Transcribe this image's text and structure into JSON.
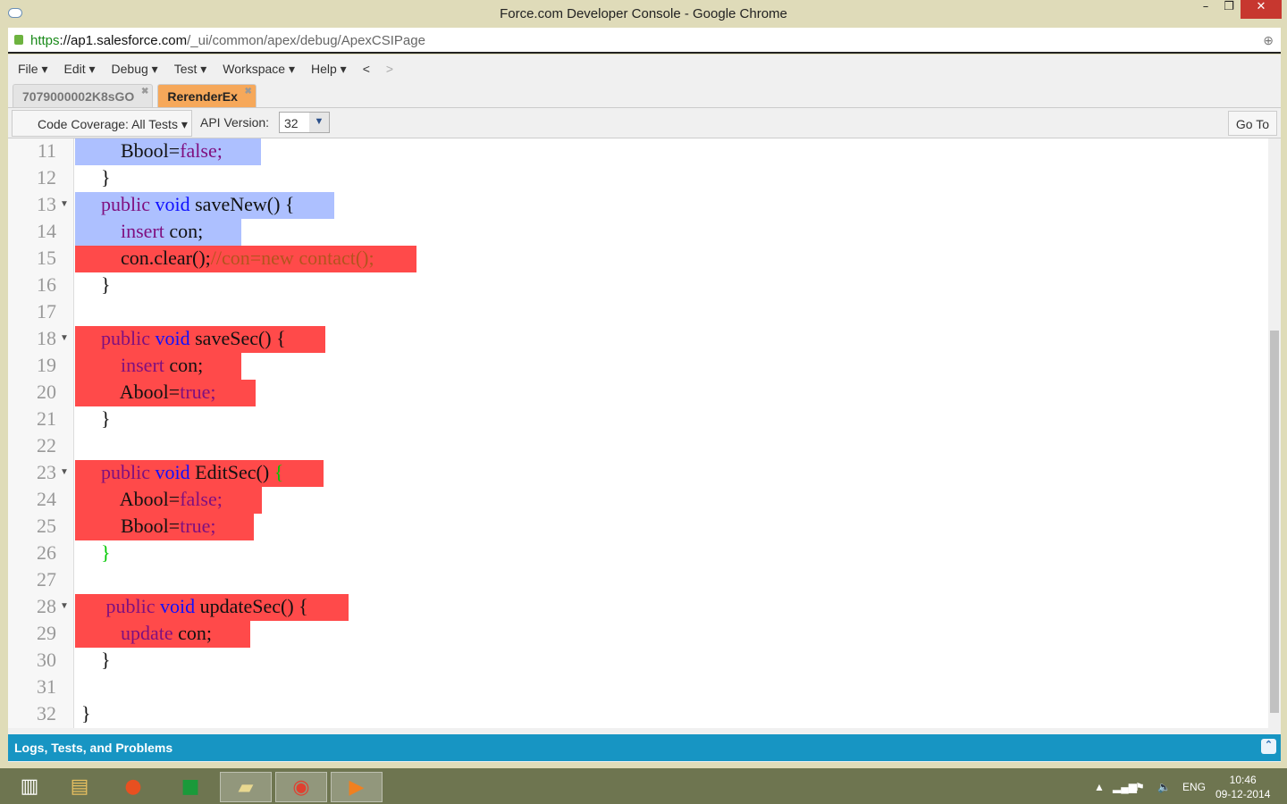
{
  "window": {
    "title": "Force.com Developer Console - Google Chrome",
    "min": "–",
    "max": "❐",
    "close": "✕"
  },
  "address": {
    "scheme": "https",
    "host": "://ap1.salesforce.com",
    "path": "/_ui/common/apex/debug/ApexCSIPage"
  },
  "menu": [
    "File ▾",
    "Edit ▾",
    "Debug ▾",
    "Test ▾",
    "Workspace ▾",
    "Help ▾",
    "<",
    ">"
  ],
  "tabs": [
    {
      "label": "7079000002K8sGO",
      "active": false
    },
    {
      "label": "RerenderEx",
      "active": true
    }
  ],
  "toolbar": {
    "coverage": "Code Coverage: All Tests  ▾",
    "api_label": "API Version:",
    "api_value": "32",
    "goto": "Go To"
  },
  "code": [
    {
      "n": "11",
      "fold": false,
      "hl": "blue",
      "tokens": [
        [
          "        ",
          ""
        ],
        [
          "Bbool=",
          ""
        ],
        [
          "false;",
          "kw"
        ]
      ]
    },
    {
      "n": "12",
      "fold": false,
      "hl": "",
      "tokens": [
        [
          "    }",
          ""
        ]
      ]
    },
    {
      "n": "13",
      "fold": true,
      "hl": "blue",
      "tokens": [
        [
          "    ",
          ""
        ],
        [
          "public ",
          "kw"
        ],
        [
          "void ",
          "ty"
        ],
        [
          "saveNew() {",
          ""
        ]
      ]
    },
    {
      "n": "14",
      "fold": false,
      "hl": "blue",
      "tokens": [
        [
          "        ",
          ""
        ],
        [
          "insert ",
          "kw"
        ],
        [
          "con;",
          ""
        ]
      ]
    },
    {
      "n": "15",
      "fold": false,
      "hl": "red",
      "tokens": [
        [
          "        ",
          ""
        ],
        [
          "con.clear();",
          ""
        ],
        [
          "//con=new contact();",
          "cm"
        ]
      ]
    },
    {
      "n": "16",
      "fold": false,
      "hl": "",
      "tokens": [
        [
          "    }",
          ""
        ]
      ]
    },
    {
      "n": "17",
      "fold": false,
      "hl": "",
      "tokens": []
    },
    {
      "n": "18",
      "fold": true,
      "hl": "red",
      "tokens": [
        [
          "    ",
          ""
        ],
        [
          "public ",
          "kw"
        ],
        [
          "void ",
          "ty"
        ],
        [
          "saveSec() {",
          ""
        ]
      ]
    },
    {
      "n": "19",
      "fold": false,
      "hl": "red",
      "tokens": [
        [
          "        ",
          ""
        ],
        [
          "insert ",
          "kw"
        ],
        [
          "con;",
          ""
        ]
      ]
    },
    {
      "n": "20",
      "fold": false,
      "hl": "red",
      "tokens": [
        [
          "        ",
          ""
        ],
        [
          "Abool=",
          ""
        ],
        [
          "true;",
          "kw"
        ]
      ]
    },
    {
      "n": "21",
      "fold": false,
      "hl": "",
      "tokens": [
        [
          "    }",
          ""
        ]
      ]
    },
    {
      "n": "22",
      "fold": false,
      "hl": "",
      "tokens": []
    },
    {
      "n": "23",
      "fold": true,
      "hl": "red",
      "tokens": [
        [
          "    ",
          ""
        ],
        [
          "public ",
          "kw"
        ],
        [
          "void ",
          "ty"
        ],
        [
          "EditSec() ",
          ""
        ],
        [
          "{",
          "br"
        ]
      ]
    },
    {
      "n": "24",
      "fold": false,
      "hl": "red",
      "tokens": [
        [
          "        ",
          ""
        ],
        [
          "Abool=",
          ""
        ],
        [
          "false;",
          "kw"
        ]
      ]
    },
    {
      "n": "25",
      "fold": false,
      "hl": "red",
      "tokens": [
        [
          "        ",
          ""
        ],
        [
          "Bbool=",
          ""
        ],
        [
          "true;",
          "kw"
        ]
      ]
    },
    {
      "n": "26",
      "fold": false,
      "hl": "",
      "tokens": [
        [
          "    ",
          ""
        ],
        [
          "}",
          "br"
        ]
      ]
    },
    {
      "n": "27",
      "fold": false,
      "hl": "",
      "tokens": []
    },
    {
      "n": "28",
      "fold": true,
      "hl": "red",
      "tokens": [
        [
          "     ",
          ""
        ],
        [
          "public ",
          "kw"
        ],
        [
          "void ",
          "ty"
        ],
        [
          "updateSec() {",
          ""
        ]
      ]
    },
    {
      "n": "29",
      "fold": false,
      "hl": "red",
      "tokens": [
        [
          "        ",
          ""
        ],
        [
          "update ",
          "kw"
        ],
        [
          "con;",
          ""
        ]
      ]
    },
    {
      "n": "30",
      "fold": false,
      "hl": "",
      "tokens": [
        [
          "    }",
          ""
        ]
      ]
    },
    {
      "n": "31",
      "fold": false,
      "hl": "",
      "tokens": []
    },
    {
      "n": "32",
      "fold": false,
      "hl": "",
      "tokens": [
        [
          "}",
          ""
        ]
      ]
    }
  ],
  "colors": {
    "blue_hl": "#adc0ff",
    "red_hl": "#ff4a4a",
    "panel": "#1795c3"
  },
  "logs": {
    "label": "Logs, Tests, and Problems"
  },
  "tray": {
    "lang": "ENG",
    "time": "10:46",
    "date": "09-12-2014"
  }
}
